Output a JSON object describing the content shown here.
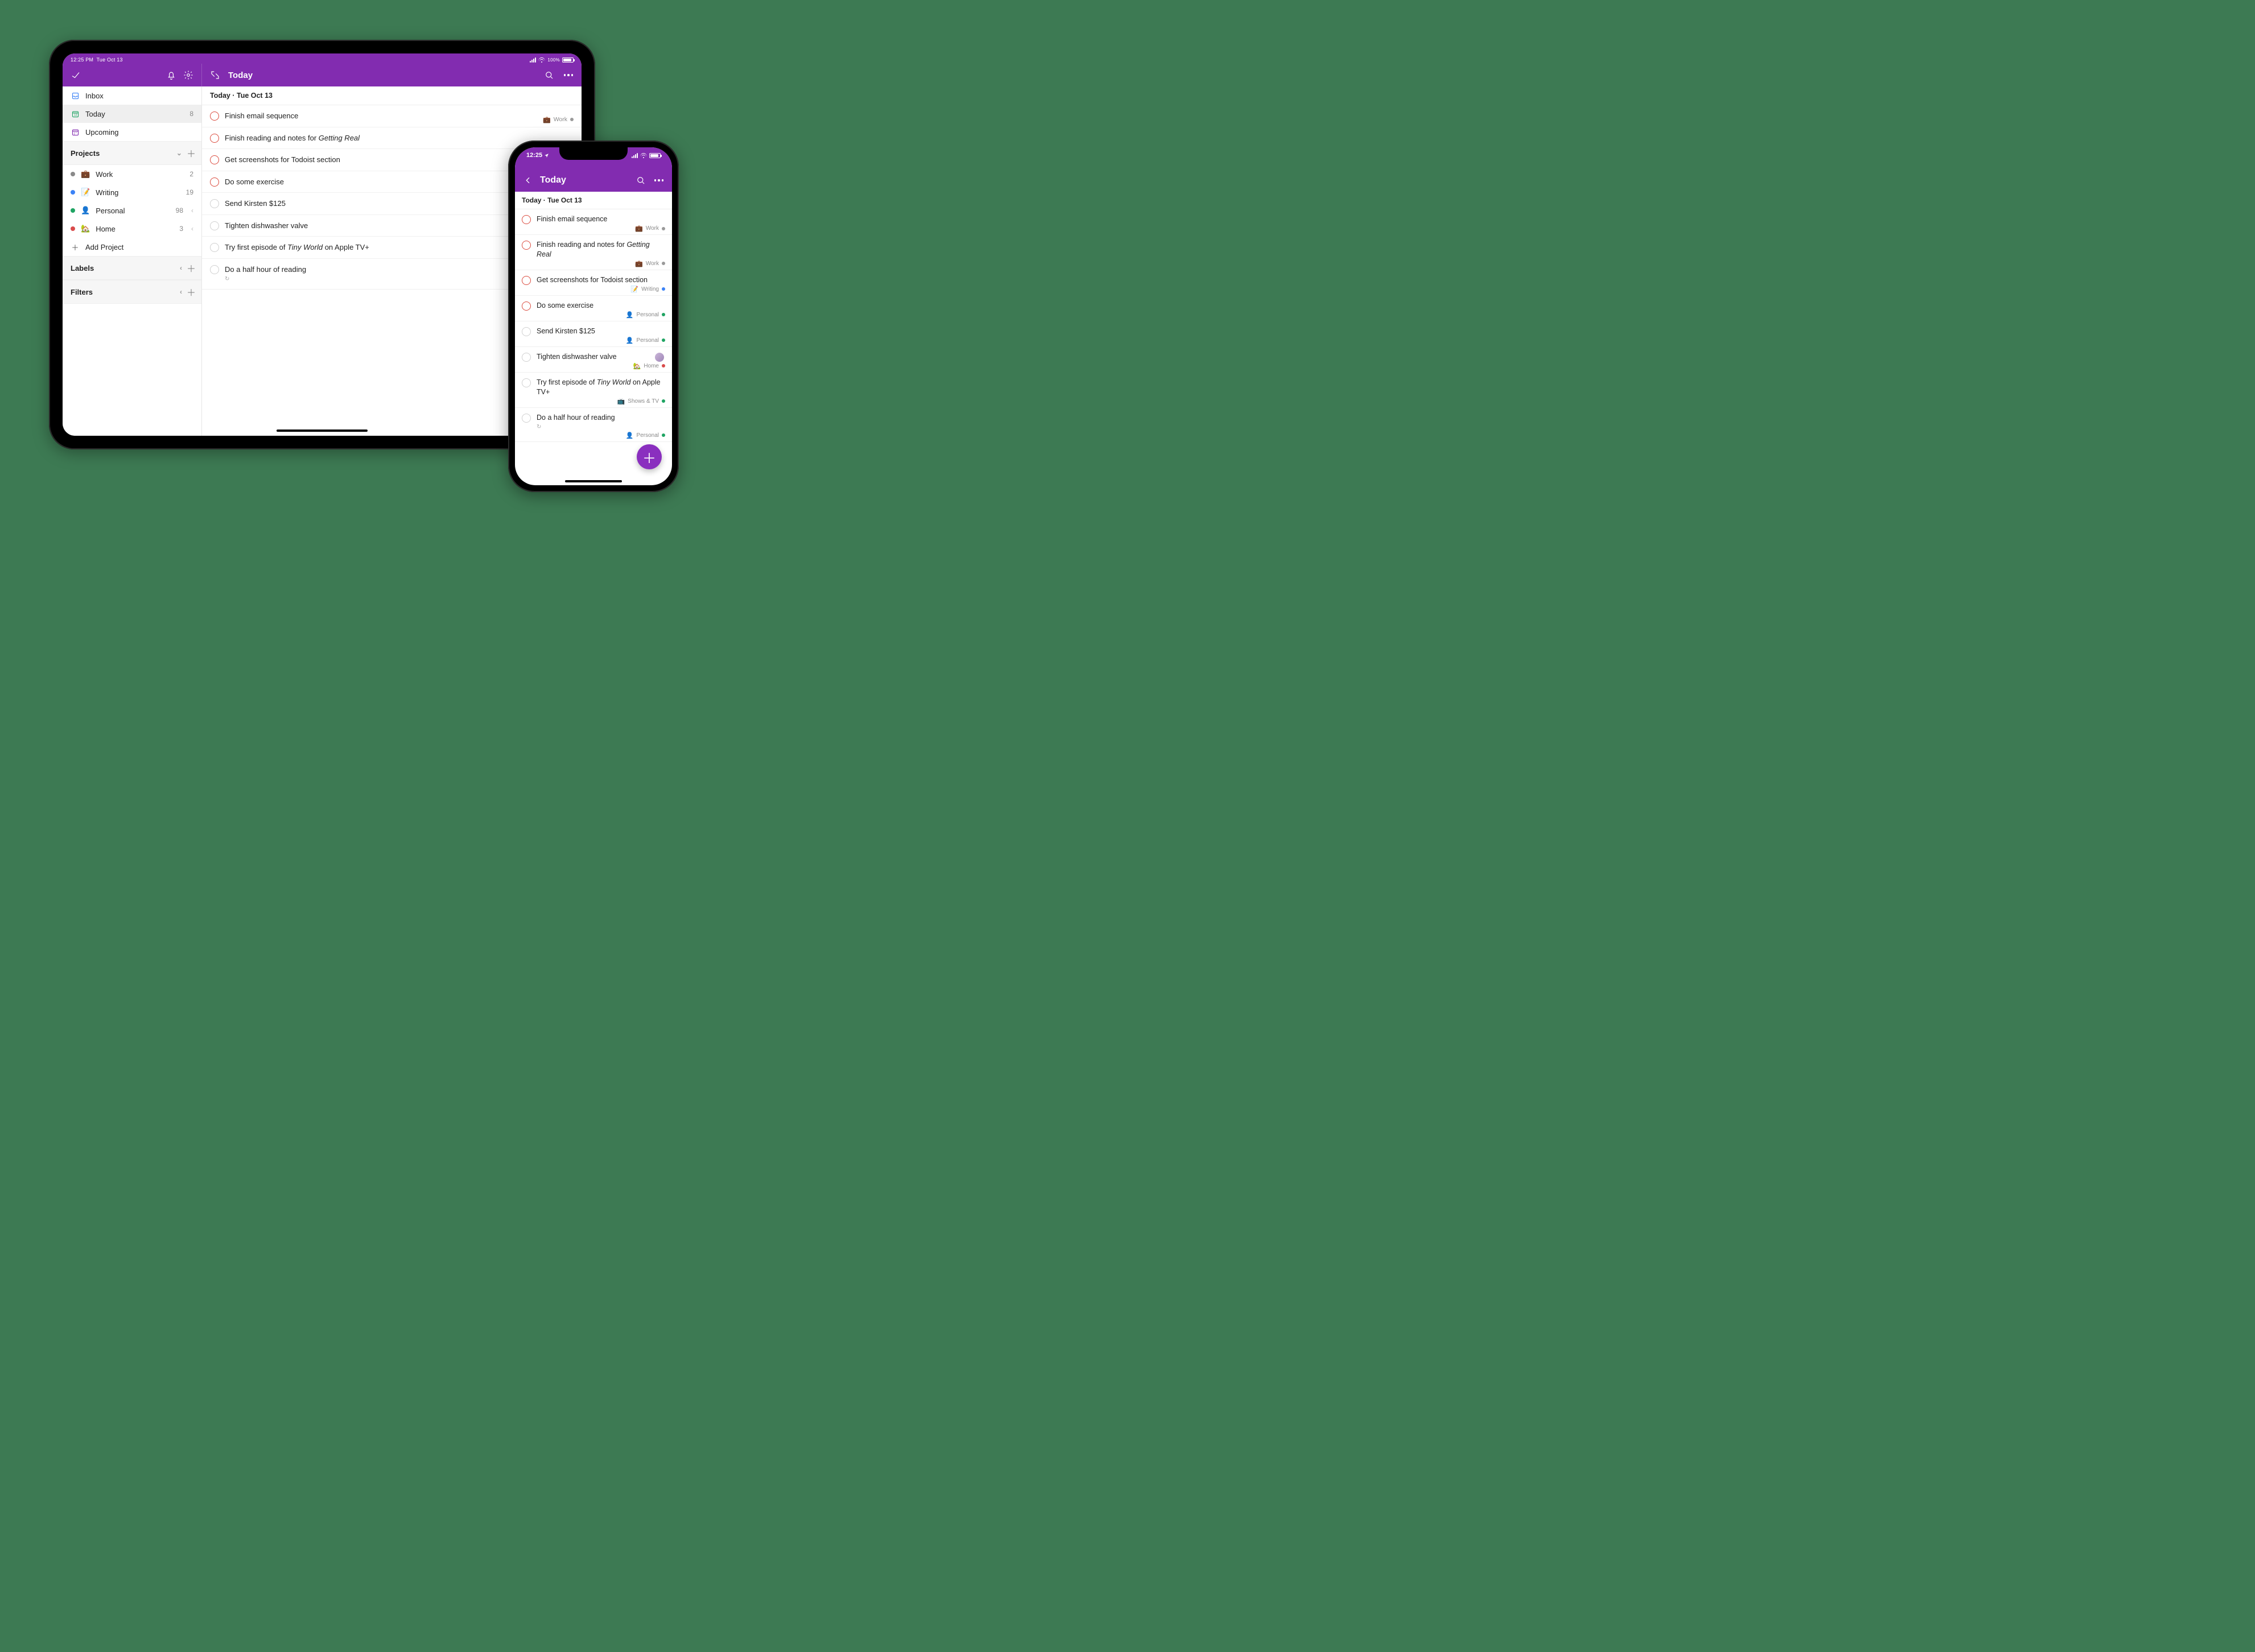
{
  "colors": {
    "accent": "#822cb0",
    "priority1": "#db4c3f"
  },
  "ipad": {
    "status": {
      "time": "12:25 PM",
      "date": "Tue Oct 13",
      "battery_label": "100%"
    },
    "toolbar": {
      "title": "Today"
    },
    "sidebar": {
      "inbox": "Inbox",
      "today": "Today",
      "today_count": "8",
      "upcoming": "Upcoming",
      "projects_header": "Projects",
      "labels_header": "Labels",
      "filters_header": "Filters",
      "add_project": "Add Project",
      "projects": [
        {
          "emoji": "💼",
          "name": "Work",
          "dot": "#8a8a8a",
          "count": "2",
          "chev": false
        },
        {
          "emoji": "📝",
          "name": "Writing",
          "dot": "#3b82f6",
          "count": "19",
          "chev": false
        },
        {
          "emoji": "👤",
          "name": "Personal",
          "dot": "#1fa463",
          "count": "98",
          "chev": true
        },
        {
          "emoji": "🏡",
          "name": "Home",
          "dot": "#d94b4b",
          "count": "3",
          "chev": true
        }
      ]
    },
    "content": {
      "section_heading": "Today · Tue Oct 13",
      "tasks": [
        {
          "priority": 1,
          "html": "Finish email sequence",
          "meta": {
            "emoji": "💼",
            "text": "Work",
            "dot": "grey"
          }
        },
        {
          "priority": 1,
          "html": "Finish reading and notes for <em>Getting Real</em>"
        },
        {
          "priority": 1,
          "html": "Get screenshots for Todoist section"
        },
        {
          "priority": 1,
          "html": "Do some exercise"
        },
        {
          "priority": 4,
          "html": "Send Kirsten $125"
        },
        {
          "priority": 4,
          "html": "Tighten dishwasher valve"
        },
        {
          "priority": 4,
          "html": "Try first episode of <em>Tiny World</em> on Apple TV+"
        },
        {
          "priority": 4,
          "html": "Do a half hour of reading",
          "recurring": true
        }
      ]
    }
  },
  "iphone": {
    "status": {
      "time": "12:25"
    },
    "toolbar": {
      "title": "Today"
    },
    "content": {
      "section_heading": "Today · Tue Oct 13",
      "tasks": [
        {
          "priority": 1,
          "html": "Finish email sequence",
          "meta": {
            "emoji": "💼",
            "text": "Work",
            "dot": "grey"
          }
        },
        {
          "priority": 1,
          "html": "Finish reading and notes for <em>Getting Real</em>",
          "meta": {
            "emoji": "💼",
            "text": "Work",
            "dot": "grey"
          }
        },
        {
          "priority": 1,
          "html": "Get screenshots for Todoist section",
          "meta": {
            "emoji": "📝",
            "text": "Writing",
            "dot": "blue"
          }
        },
        {
          "priority": 1,
          "html": "Do some exercise",
          "meta": {
            "emoji": "👤",
            "text": "Personal",
            "dot": "green"
          }
        },
        {
          "priority": 4,
          "html": "Send Kirsten $125",
          "meta": {
            "emoji": "👤",
            "text": "Personal",
            "dot": "green"
          }
        },
        {
          "priority": 4,
          "html": "Tighten dishwasher valve",
          "avatar": true,
          "meta": {
            "emoji": "🏡",
            "text": "Home",
            "dot": "red"
          }
        },
        {
          "priority": 4,
          "html": "Try first episode of <em>Tiny World</em> on Apple TV+",
          "meta": {
            "emoji": "📺",
            "text": "Shows & TV",
            "dot": "green"
          }
        },
        {
          "priority": 4,
          "html": "Do a half hour of reading",
          "recurring": true,
          "meta": {
            "emoji": "👤",
            "text": "Personal",
            "dot": "green"
          }
        }
      ]
    }
  }
}
